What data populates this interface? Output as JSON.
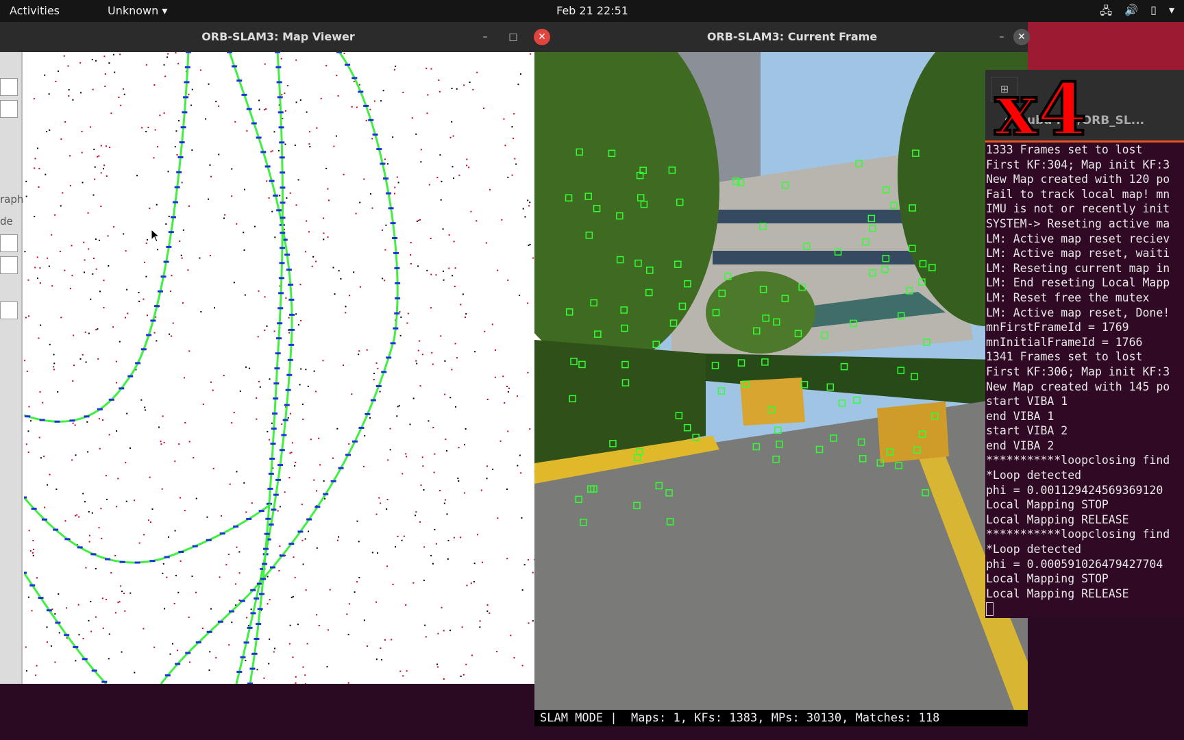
{
  "topbar": {
    "activities": "Activities",
    "app_menu": "Unknown ▾",
    "clock": "Feb 21  22:51",
    "tray": [
      "network-icon",
      "volume-icon",
      "battery-icon",
      "system-menu-icon"
    ]
  },
  "map_viewer": {
    "title": "ORB-SLAM3: Map Viewer",
    "panel_labels": [
      "raph",
      "de"
    ],
    "colors": {
      "keyframes": "#2030e0",
      "graph": "#40f040",
      "map_points": "#cc0020",
      "ref_points": "#000000"
    }
  },
  "current_frame": {
    "title": "ORB-SLAM3: Current Frame",
    "status": "SLAM MODE |  Maps: 1, KFs: 1383, MPs: 30130, Matches: 118",
    "feature_color": "#30ff30"
  },
  "terminal": {
    "title": "s   @ubu    :pp/ORB_SL...",
    "overlay": "x4",
    "lines": [
      "1333 Frames set to lost",
      "First KF:304; Map init KF:3",
      "New Map created with 120 po",
      "Fail to track local map! mn",
      "IMU is not or recently init",
      "SYSTEM-> Reseting active ma",
      "LM: Active map reset reciev",
      "LM: Active map reset, waiti",
      "LM: Reseting current map in",
      "LM: End reseting Local Mapp",
      "LM: Reset free the mutex",
      "LM: Active map reset, Done!",
      "mnFirstFrameId = 1769",
      "mnInitialFrameId = 1766",
      "1341 Frames set to lost",
      "First KF:306; Map init KF:3",
      "New Map created with 145 po",
      "start VIBA 1",
      "end VIBA 1",
      "start VIBA 2",
      "end VIBA 2",
      "***********loopclosing find",
      "*Loop detected",
      "phi = 0.001129424569369120",
      "Local Mapping STOP",
      "Local Mapping RELEASE",
      "***********loopclosing find",
      "*Loop detected",
      "phi = 0.000591026479427704",
      "Local Mapping STOP",
      "Local Mapping RELEASE"
    ]
  }
}
